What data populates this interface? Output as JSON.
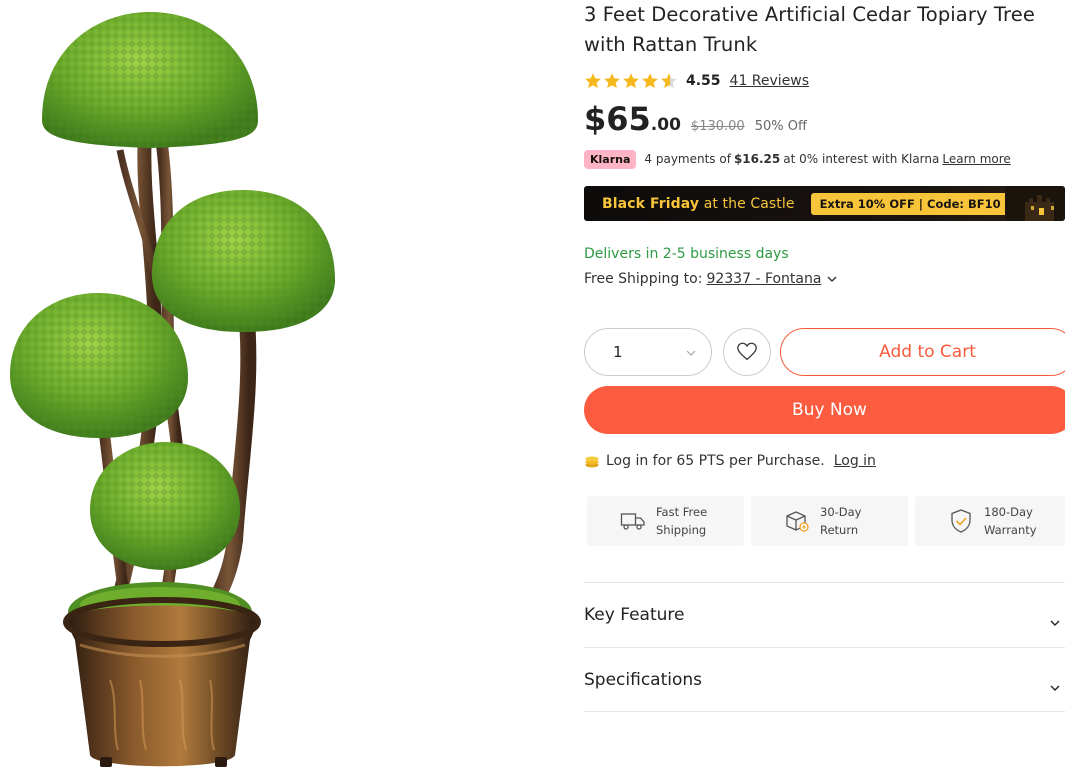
{
  "product": {
    "title": "3 Feet Decorative Artificial Cedar Topiary Tree with Rattan Trunk",
    "rating": "4.55",
    "reviews": "41 Reviews",
    "price_main": "$65",
    "price_cents": ".00",
    "price_old": "$130.00",
    "discount": "50% Off"
  },
  "klarna": {
    "badge": "Klarna",
    "text_prefix": "4 payments of",
    "amount": "$16.25",
    "text_suffix": "at 0% interest with Klarna",
    "learn_more": "Learn more"
  },
  "banner": {
    "headline_bold": "Black Friday",
    "headline_rest": " at the Castle",
    "code": "Extra 10% OFF  |  Code: BF10"
  },
  "delivery": {
    "eta": "Delivers in 2-5 business days",
    "shipping_label": "Free Shipping to:",
    "zip": "92337 - Fontana"
  },
  "purchase": {
    "quantity": "1",
    "add_to_cart": "Add to Cart",
    "buy_now": "Buy Now"
  },
  "points": {
    "text": "Log in for 65 PTS per Purchase.",
    "login": "Log in"
  },
  "perks": [
    {
      "icon": "truck-icon",
      "line1": "Fast Free",
      "line2": "Shipping"
    },
    {
      "icon": "return-box-icon",
      "line1": "30-Day",
      "line2": "Return"
    },
    {
      "icon": "shield-check-icon",
      "line1": "180-Day",
      "line2": "Warranty"
    }
  ],
  "accordions": [
    "Key Feature",
    "Specifications"
  ],
  "colors": {
    "accent": "#fb5c40",
    "star": "#f5b81f",
    "delivery_green": "#2e9a43",
    "klarna_pink": "#ffb3c7",
    "banner_gold": "#f8c53a"
  }
}
